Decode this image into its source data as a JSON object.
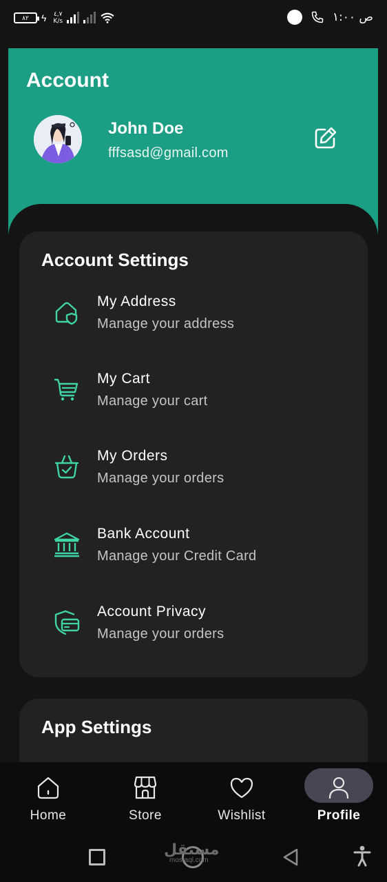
{
  "status_bar": {
    "battery": "٨٢",
    "speed_value": "٤,٧",
    "speed_unit": "K/s",
    "time": "ص ١:٠٠"
  },
  "header": {
    "title": "Account",
    "user_name": "John Doe",
    "user_email": "fffsasd@gmail.com"
  },
  "account_settings": {
    "title": "Account Settings",
    "items": [
      {
        "icon": "home-shield-icon",
        "title": "My Address",
        "subtitle": "Manage your address"
      },
      {
        "icon": "cart-icon",
        "title": "My Cart",
        "subtitle": "Manage your cart"
      },
      {
        "icon": "basket-check-icon",
        "title": "My Orders",
        "subtitle": "Manage your orders"
      },
      {
        "icon": "bank-icon",
        "title": "Bank Account",
        "subtitle": "Manage your Credit Card"
      },
      {
        "icon": "card-shield-icon",
        "title": "Account Privacy",
        "subtitle": "Manage your orders"
      }
    ]
  },
  "app_settings": {
    "title": "App Settings"
  },
  "bottom_nav": {
    "items": [
      {
        "icon": "home-icon",
        "label": "Home"
      },
      {
        "icon": "store-icon",
        "label": "Store"
      },
      {
        "icon": "heart-icon",
        "label": "Wishlist"
      },
      {
        "icon": "user-icon",
        "label": "Profile"
      }
    ],
    "active": "Profile"
  },
  "watermark": {
    "text": "مستقل",
    "sub": "mostaql.com"
  },
  "colors": {
    "accent": "#1b9e84",
    "icon": "#3fd3a6",
    "card": "#222222",
    "background": "#141414",
    "active_pill": "#4a4554"
  }
}
